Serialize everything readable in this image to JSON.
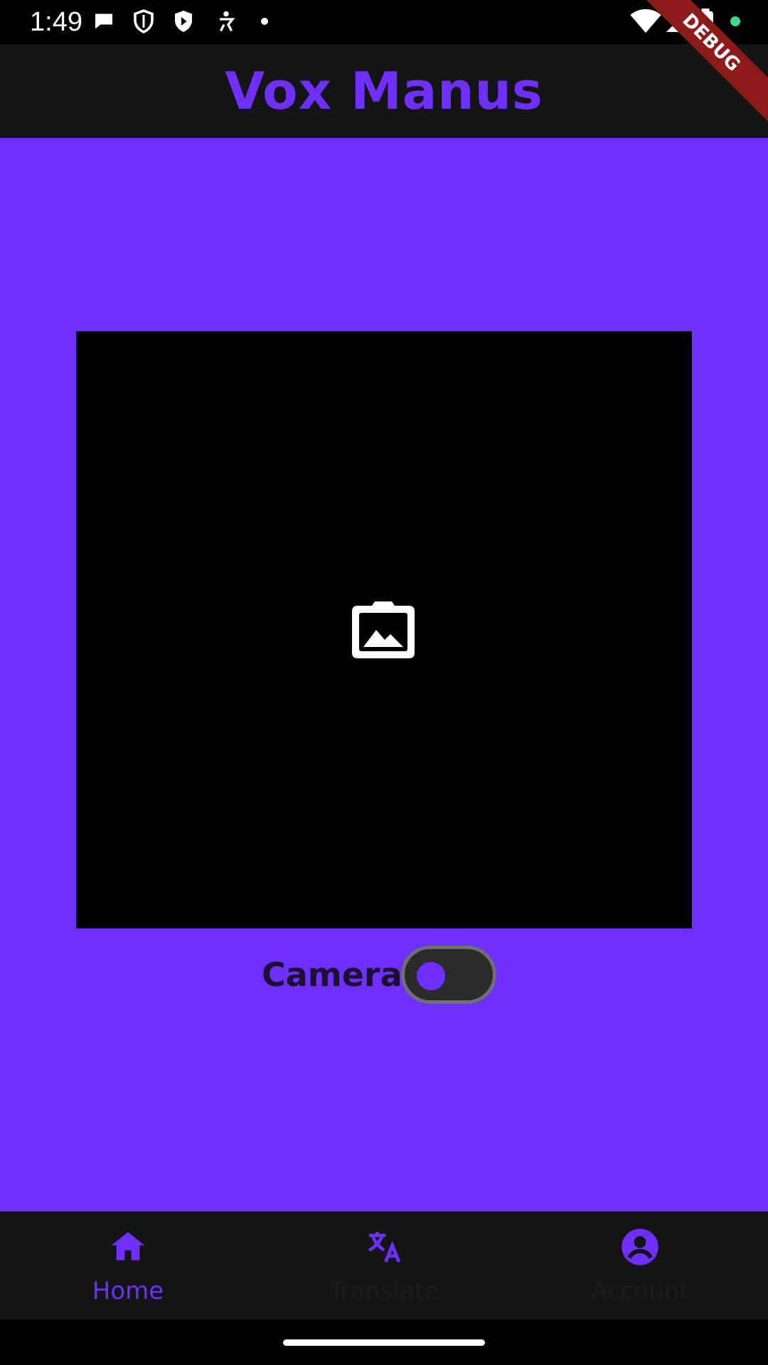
{
  "status_bar": {
    "time": "1:49",
    "left_icons": [
      "chat-bubble-icon",
      "shield-icon",
      "play-shield-icon",
      "accessibility-icon",
      "dot-icon"
    ],
    "right_icons": [
      "wifi-icon",
      "cell-signal-icon",
      "battery-icon",
      "privacy-dot-icon"
    ]
  },
  "app_bar": {
    "title": "Vox Manus",
    "debug_banner": "DEBUG"
  },
  "main": {
    "preview_icon": "gallery-icon",
    "camera_label": "Camera",
    "camera_toggle_on": false
  },
  "bottom_nav": {
    "items": [
      {
        "label": "Home",
        "icon": "home-icon",
        "active": true
      },
      {
        "label": "Translate",
        "icon": "translate-icon",
        "active": false
      },
      {
        "label": "Account",
        "icon": "account-icon",
        "active": false
      }
    ]
  },
  "colors": {
    "accent": "#6F2FFE",
    "bar_background": "#141414",
    "preview_background": "#000000",
    "debug_banner": "#8E1B1B"
  }
}
